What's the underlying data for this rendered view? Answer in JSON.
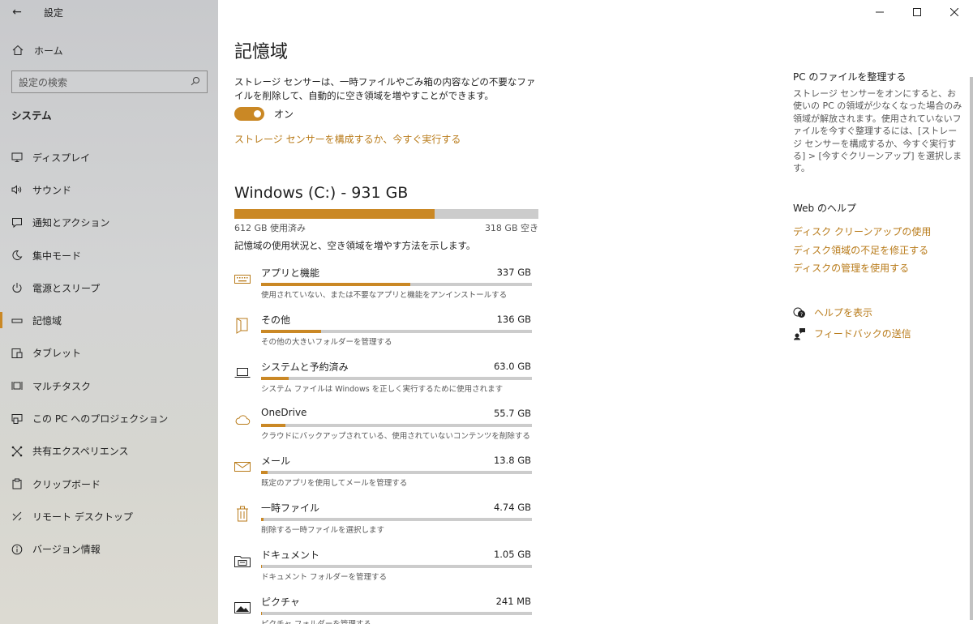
{
  "app": {
    "title": "設定"
  },
  "colors": {
    "accent": "#ca8825",
    "link": "#b87a18",
    "bar_track": "#cccccc"
  },
  "sidebar": {
    "home": "ホーム",
    "search_placeholder": "設定の検索",
    "section": "システム",
    "items": [
      {
        "label": "ディスプレイ",
        "icon": "display-icon"
      },
      {
        "label": "サウンド",
        "icon": "speaker-icon"
      },
      {
        "label": "通知とアクション",
        "icon": "notification-icon"
      },
      {
        "label": "集中モード",
        "icon": "moon-icon"
      },
      {
        "label": "電源とスリープ",
        "icon": "power-icon"
      },
      {
        "label": "記憶域",
        "icon": "storage-icon",
        "active": true
      },
      {
        "label": "タブレット",
        "icon": "tablet-icon"
      },
      {
        "label": "マルチタスク",
        "icon": "multitask-icon"
      },
      {
        "label": "この PC へのプロジェクション",
        "icon": "projection-icon"
      },
      {
        "label": "共有エクスペリエンス",
        "icon": "share-icon"
      },
      {
        "label": "クリップボード",
        "icon": "clipboard-icon"
      },
      {
        "label": "リモート デスクトップ",
        "icon": "remote-desktop-icon"
      },
      {
        "label": "バージョン情報",
        "icon": "info-icon"
      }
    ]
  },
  "main": {
    "title": "記憶域",
    "description": "ストレージ センサーは、一時ファイルやごみ箱の内容などの不要なファイルを削除して、自動的に空き領域を増やすことができます。",
    "toggle_label": "オン",
    "toggle_on": true,
    "configure_link": "ストレージ センサーを構成するか、今すぐ実行する",
    "drive": {
      "title": "Windows (C:) - 931 GB",
      "used_label": "612 GB 使用済み",
      "free_label": "318 GB 空き",
      "used_fraction": 0.658
    },
    "usage_hint": "記憶域の使用状況と、空き領域を増やす方法を示します。",
    "categories": [
      {
        "name": "アプリと機能",
        "size": "337 GB",
        "desc": "使用されていない、または不要なアプリと機能をアンインストールする",
        "fraction": 0.551,
        "icon": "keyboard-icon"
      },
      {
        "name": "その他",
        "size": "136 GB",
        "desc": "その他の大きいフォルダーを管理する",
        "fraction": 0.222,
        "icon": "other-folder-icon"
      },
      {
        "name": "システムと予約済み",
        "size": "63.0 GB",
        "desc": "システム ファイルは Windows を正しく実行するために使用されます",
        "fraction": 0.103,
        "icon": "laptop-icon"
      },
      {
        "name": "OneDrive",
        "size": "55.7 GB",
        "desc": "クラウドにバックアップされている、使用されていないコンテンツを削除する",
        "fraction": 0.091,
        "icon": "cloud-icon"
      },
      {
        "name": "メール",
        "size": "13.8 GB",
        "desc": "既定のアプリを使用してメールを管理する",
        "fraction": 0.023,
        "icon": "mail-icon"
      },
      {
        "name": "一時ファイル",
        "size": "4.74 GB",
        "desc": "削除する一時ファイルを選択します",
        "fraction": 0.008,
        "icon": "trash-icon"
      },
      {
        "name": "ドキュメント",
        "size": "1.05 GB",
        "desc": "ドキュメント フォルダーを管理する",
        "fraction": 0.002,
        "icon": "documents-folder-icon"
      },
      {
        "name": "ピクチャ",
        "size": "241 MB",
        "desc": "ピクチャ フォルダーを管理する",
        "fraction": 0.0005,
        "icon": "pictures-icon"
      }
    ]
  },
  "right": {
    "heading": "PC のファイルを整理する",
    "body": "ストレージ センサーをオンにすると、お使いの PC の領域が少なくなった場合のみ領域が解放されます。使用されていないファイルを今すぐ整理するには、[ストレージ センサーを構成するか、今すぐ実行する] > [今すぐクリーンアップ] を選択します。",
    "web_help_heading": "Web のヘルプ",
    "links": [
      "ディスク クリーンアップの使用",
      "ディスク領域の不足を修正する",
      "ディスクの管理を使用する"
    ],
    "help_label": "ヘルプを表示",
    "feedback_label": "フィードバックの送信"
  },
  "window_controls": {
    "minimize": "—",
    "maximize": "☐",
    "close": "✕"
  }
}
